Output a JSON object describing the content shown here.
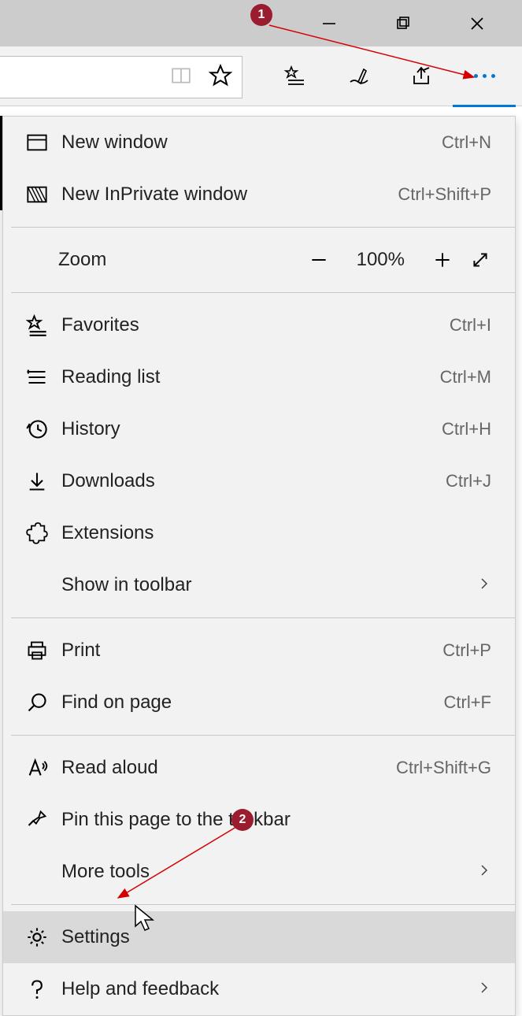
{
  "menu": {
    "new_window": {
      "label": "New window",
      "shortcut": "Ctrl+N"
    },
    "new_inprivate": {
      "label": "New InPrivate window",
      "shortcut": "Ctrl+Shift+P"
    },
    "zoom": {
      "label": "Zoom",
      "value": "100%"
    },
    "favorites": {
      "label": "Favorites",
      "shortcut": "Ctrl+I"
    },
    "reading_list": {
      "label": "Reading list",
      "shortcut": "Ctrl+M"
    },
    "history": {
      "label": "History",
      "shortcut": "Ctrl+H"
    },
    "downloads": {
      "label": "Downloads",
      "shortcut": "Ctrl+J"
    },
    "extensions": {
      "label": "Extensions"
    },
    "show_in_toolbar": {
      "label": "Show in toolbar"
    },
    "print": {
      "label": "Print",
      "shortcut": "Ctrl+P"
    },
    "find_on_page": {
      "label": "Find on page",
      "shortcut": "Ctrl+F"
    },
    "read_aloud": {
      "label": "Read aloud",
      "shortcut": "Ctrl+Shift+G"
    },
    "pin_taskbar": {
      "label": "Pin this page to the taskbar"
    },
    "more_tools": {
      "label": "More tools"
    },
    "settings": {
      "label": "Settings"
    },
    "help": {
      "label": "Help and feedback"
    }
  },
  "annotations": {
    "step1": "1",
    "step2": "2"
  }
}
